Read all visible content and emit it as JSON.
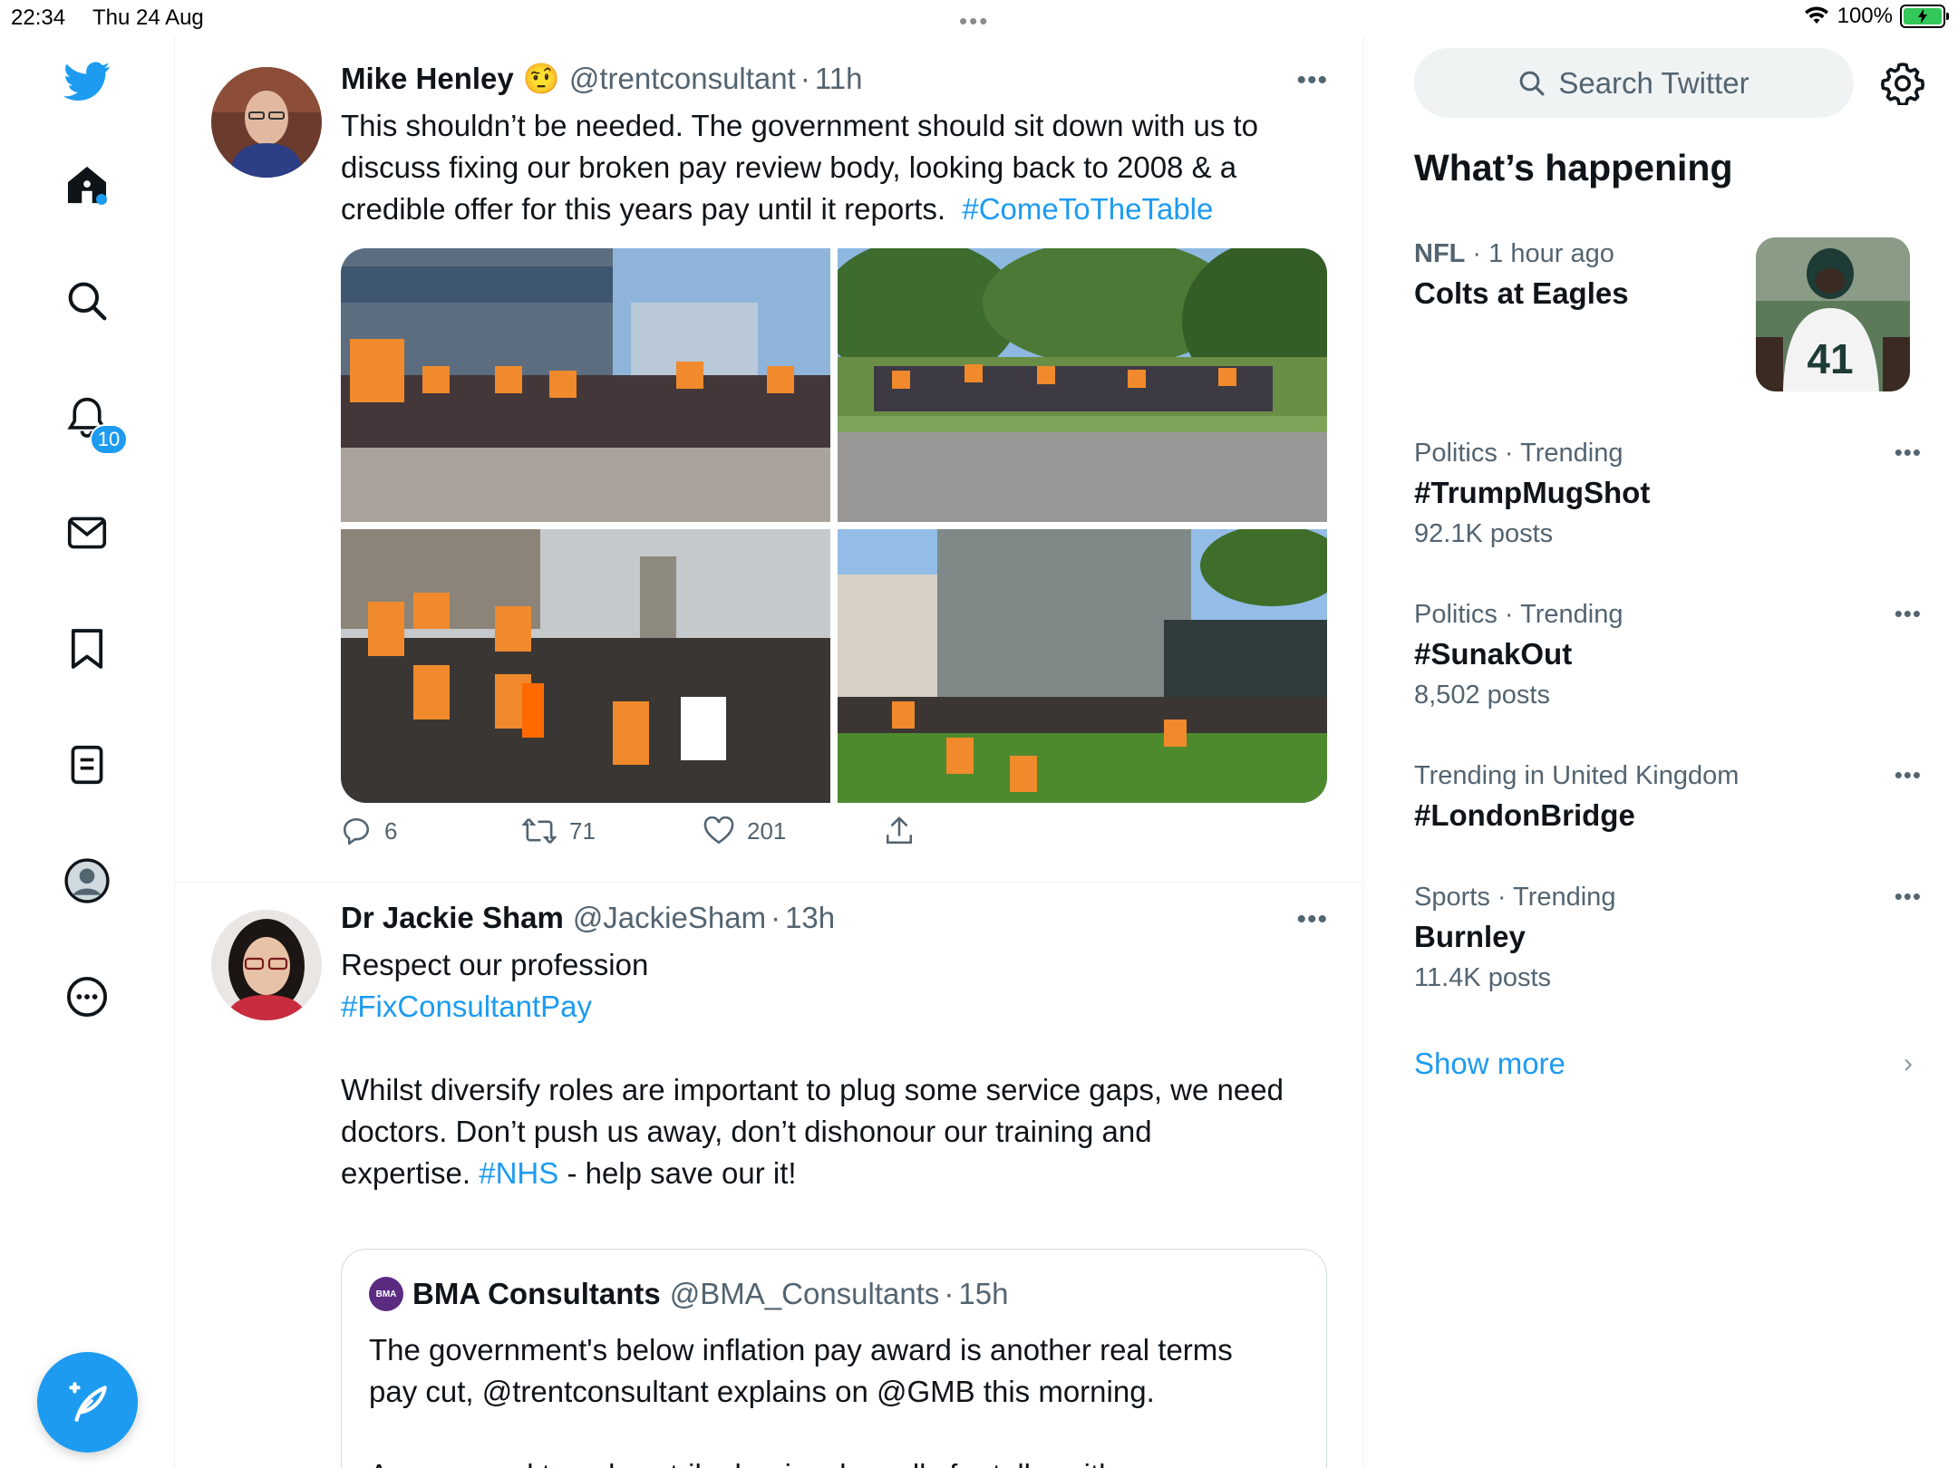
{
  "status_bar": {
    "time": "22:34",
    "date": "Thu 24 Aug",
    "battery": "100%",
    "center_dots": "•••"
  },
  "nav": {
    "notifications_badge": "10",
    "icons": [
      "twitter-logo-icon",
      "home-icon",
      "search-icon",
      "bell-icon",
      "mail-icon",
      "bookmark-icon",
      "list-icon",
      "profile-icon",
      "more-icon"
    ]
  },
  "colors": {
    "accent": "#1d9bf0",
    "text": "#0f1419",
    "secondary": "#536471"
  },
  "tweets": [
    {
      "name": "Mike Henley",
      "emoji": "🤨",
      "handle": "@trentconsultant",
      "time": "11h",
      "more": "•••",
      "text_line1": "This shouldn’t be needed. The government should sit down with us to",
      "text_line2": "discuss fixing our broken pay review body, looking back to 2008 & a",
      "text_line3": "credible offer for this years pay until it reports.",
      "hashtag": "#ComeToTheTable",
      "replies": "6",
      "retweets": "71",
      "likes": "201"
    },
    {
      "name": "Dr Jackie Sham",
      "handle": "@JackieSham",
      "time": "13h",
      "more": "•••",
      "text_line1": "Respect our profession",
      "hashtag1": "#FixConsultantPay",
      "text_line2": "Whilst diversify roles are important to plug some service gaps, we need",
      "text_line3": "doctors. Don’t push us away, don’t dishonour our training and",
      "text_line4_pre": "expertise.",
      "hashtag2": "#NHS",
      "text_line4_post": "- help save our it!",
      "quote": {
        "logo": "BMA",
        "name": "BMA Consultants",
        "handle": "@BMA_Consultants",
        "time": "15h",
        "text_line1": "The government's below inflation pay award is another real terms",
        "text_line2": "pay cut, @trentconsultant explains on @GMB this morning.",
        "text_line3": "As a second two-day strike begins, he calls for talks with"
      }
    }
  ],
  "sidebar": {
    "search_placeholder": "Search Twitter",
    "title": "What’s happening",
    "trends": [
      {
        "category": "NFL",
        "meta": "1 hour ago",
        "name": "Colts at Eagles",
        "count": ""
      },
      {
        "category": "Politics · Trending",
        "meta": "",
        "name": "#TrumpMugShot",
        "count": "92.1K posts"
      },
      {
        "category": "Politics · Trending",
        "meta": "",
        "name": "#SunakOut",
        "count": "8,502 posts"
      },
      {
        "category": "Trending in United Kingdom",
        "meta": "",
        "name": "#LondonBridge",
        "count": ""
      },
      {
        "category": "Sports · Trending",
        "meta": "",
        "name": "Burnley",
        "count": "11.4K posts"
      }
    ],
    "show_more": "Show more"
  }
}
